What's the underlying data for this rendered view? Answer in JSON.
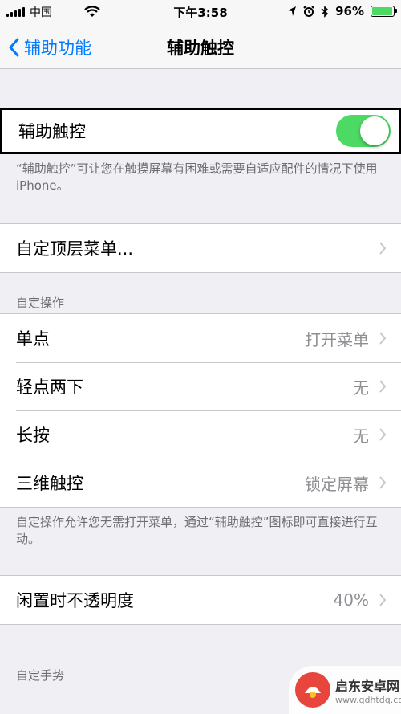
{
  "status_bar": {
    "carrier": "中国",
    "time": "下午3:58",
    "battery_percent_label": "96%",
    "battery_level": 0.96,
    "battery_color": "#4cd964"
  },
  "nav": {
    "back_label": "辅助功能",
    "title": "辅助触控"
  },
  "assistive_touch": {
    "label": "辅助触控",
    "toggle_on": true,
    "description": "“辅助触控”可让您在触摸屏幕有困难或需要自适应配件的情况下使用 iPhone。"
  },
  "customize_menu": {
    "label": "自定顶层菜单..."
  },
  "custom_actions": {
    "header": "自定操作",
    "rows": [
      {
        "label": "单点",
        "value": "打开菜单"
      },
      {
        "label": "轻点两下",
        "value": "无"
      },
      {
        "label": "长按",
        "value": "无"
      },
      {
        "label": "三维触控",
        "value": "锁定屏幕"
      }
    ],
    "footer": "自定操作允许您无需打开菜单，通过“辅助触控”图标即可直接进行互动。"
  },
  "idle_opacity": {
    "label": "闲置时不透明度",
    "value": "40%"
  },
  "custom_gestures": {
    "header": "自定手势"
  },
  "watermark": {
    "title": "启东安卓网",
    "url": "www.qdhtdq.com"
  },
  "colors": {
    "accent": "#007aff",
    "toggle_on": "#4cd964",
    "background": "#efeff4"
  }
}
